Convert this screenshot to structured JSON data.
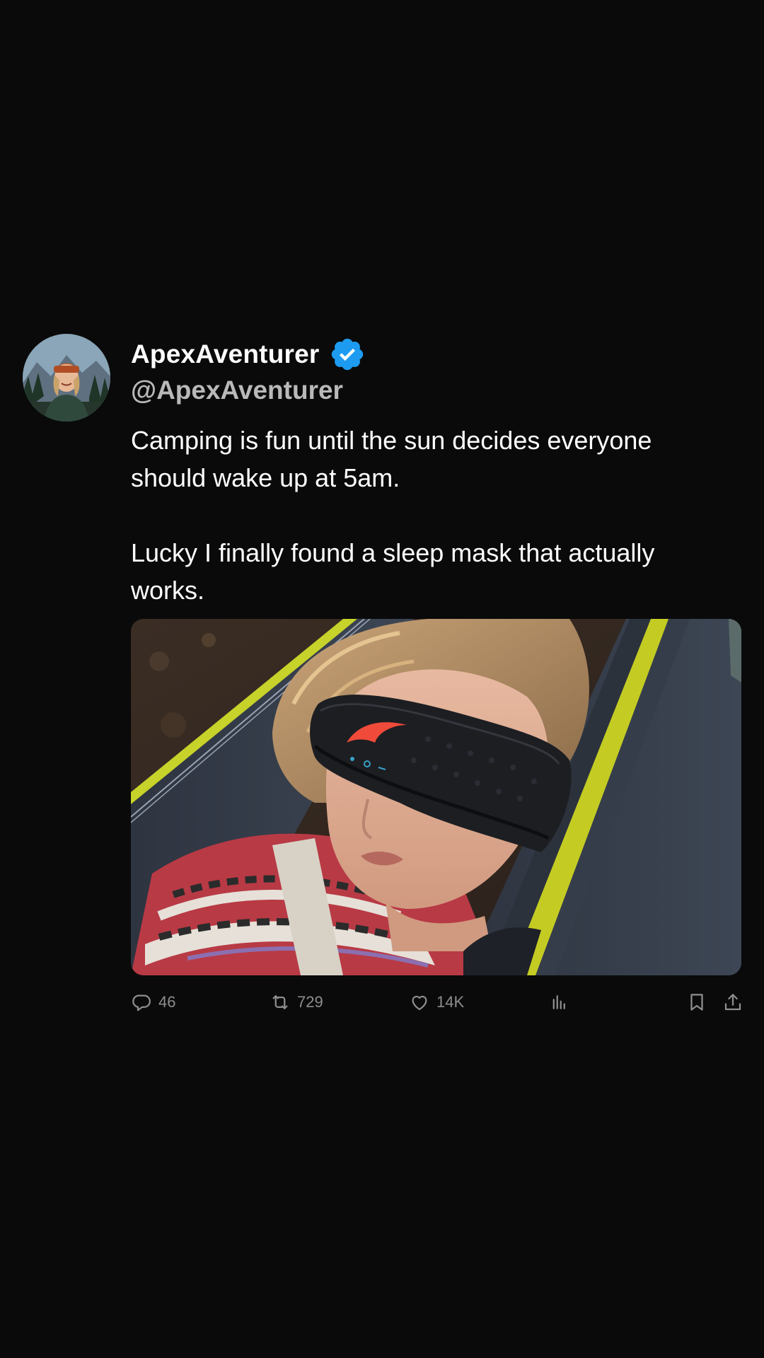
{
  "post": {
    "display_name": "ApexAventurer",
    "handle": "@ApexAventurer",
    "verified": true,
    "text": "Camping is fun until the sun decides everyone should wake up at 5am.\n\nLucky I finally found a sleep mask that actually works.",
    "actions": {
      "replies": "46",
      "reposts": "729",
      "likes": "14K"
    }
  },
  "icons": {
    "verified": "verified-badge-icon",
    "reply": "reply-icon",
    "repost": "repost-icon",
    "like": "heart-icon",
    "views": "views-chart-icon",
    "bookmark": "bookmark-icon",
    "share": "share-icon"
  },
  "colors": {
    "background": "#0a0a0a",
    "verified_blue": "#1d9bf0",
    "muted": "#8e8e8e",
    "handle": "#b9b9b9"
  }
}
